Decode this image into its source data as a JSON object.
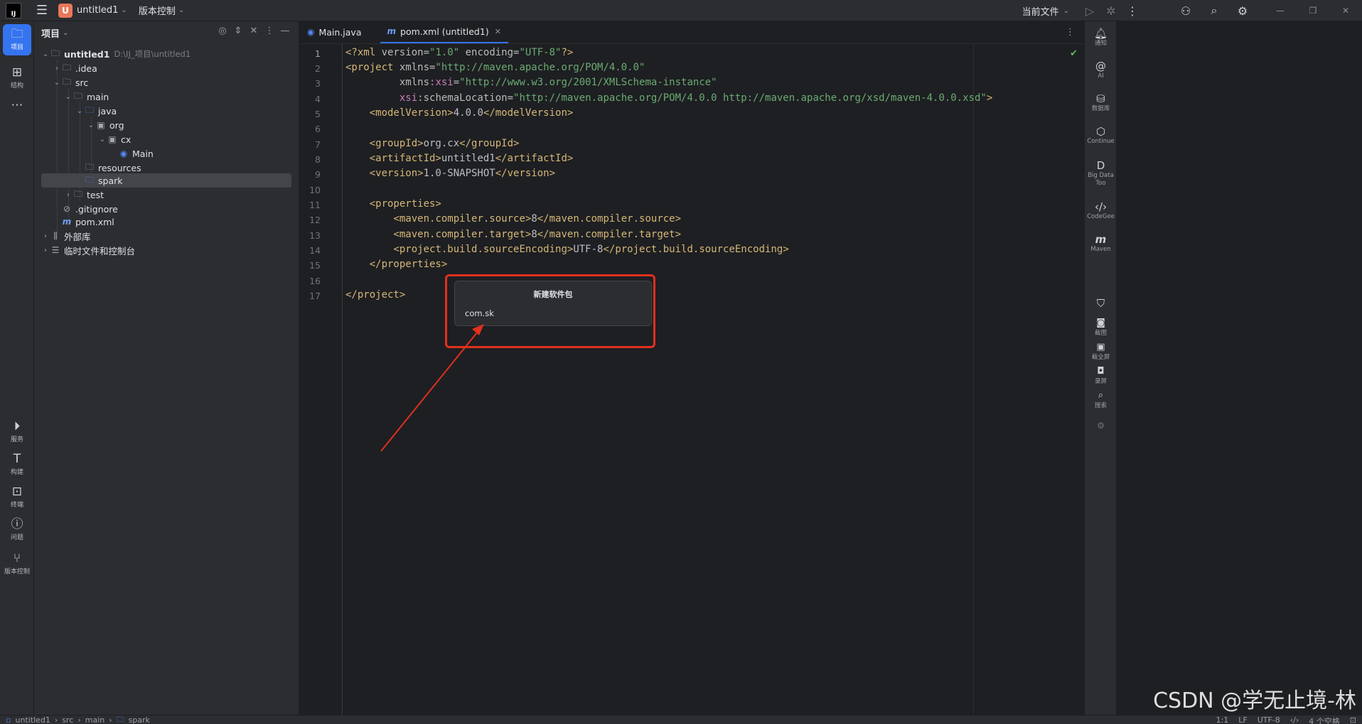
{
  "titlebar": {
    "logo": "IJ",
    "project_badge": "U",
    "project_name": "untitled1",
    "vcs": "版本控制",
    "run_config": "当前文件"
  },
  "left_strip": {
    "items": [
      {
        "label": "项目",
        "icon": "folder-icon"
      },
      {
        "label": "结构",
        "icon": "structure-icon"
      },
      {
        "label": "服务",
        "icon": "services-icon"
      },
      {
        "label": "构建",
        "icon": "build-icon"
      },
      {
        "label": "终端",
        "icon": "terminal-icon"
      },
      {
        "label": "问题",
        "icon": "problems-icon"
      },
      {
        "label": "版本控制",
        "icon": "vcs-icon"
      }
    ]
  },
  "project_panel": {
    "title": "项目",
    "tree": [
      {
        "name": "untitled1",
        "path": "D:\\IJ_项目\\untitled1"
      },
      {
        "name": ".idea"
      },
      {
        "name": "src"
      },
      {
        "name": "main"
      },
      {
        "name": "java"
      },
      {
        "name": "org"
      },
      {
        "name": "cx"
      },
      {
        "name": "Main"
      },
      {
        "name": "resources"
      },
      {
        "name": "spark"
      },
      {
        "name": "test"
      },
      {
        "name": ".gitignore"
      },
      {
        "name": "pom.xml"
      },
      {
        "name": "外部库"
      },
      {
        "name": "临时文件和控制台"
      }
    ]
  },
  "editor": {
    "tabs": [
      {
        "label": "Main.java"
      },
      {
        "label": "pom.xml (untitled1)"
      }
    ],
    "line_numbers": [
      "1",
      "2",
      "3",
      "4",
      "5",
      "6",
      "7",
      "8",
      "9",
      "10",
      "11",
      "12",
      "13",
      "14",
      "15",
      "16",
      "17"
    ]
  },
  "popup": {
    "title": "新建软件包",
    "input_value": "com.sk"
  },
  "right_strip": {
    "items": [
      {
        "label": "通知"
      },
      {
        "label": "AI"
      },
      {
        "label": "数据库"
      },
      {
        "label": "Continue"
      },
      {
        "label": "Big Data Too"
      },
      {
        "label": "CodeGee"
      },
      {
        "label": "Maven"
      },
      {
        "label": "截图"
      },
      {
        "label": "截全屏"
      },
      {
        "label": "录屏"
      },
      {
        "label": "搜索"
      }
    ]
  },
  "statusbar": {
    "crumbs": [
      "untitled1",
      "src",
      "main",
      "spark"
    ],
    "position": "1:1",
    "line_sep": "LF",
    "encoding": "UTF-8",
    "indent": "4 个空格"
  },
  "watermark": "CSDN @学无止境-林"
}
